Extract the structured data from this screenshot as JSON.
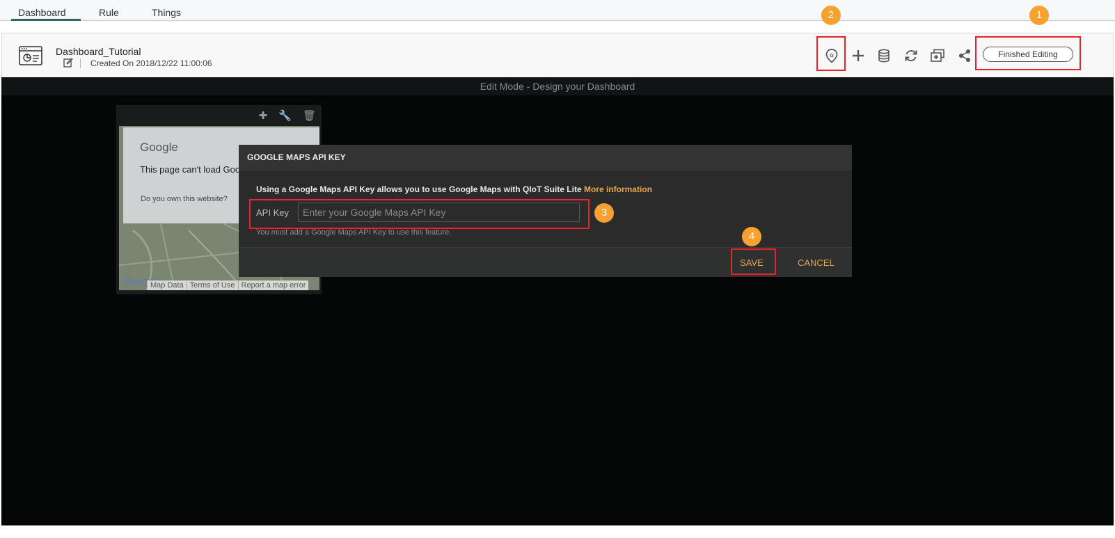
{
  "tabs": [
    {
      "label": "Dashboard"
    },
    {
      "label": "Rule"
    },
    {
      "label": "Things"
    }
  ],
  "header": {
    "title": "Dashboard_Tutorial",
    "created": "Created On 2018/12/22 11:00:06",
    "finish_label": "Finished Editing",
    "toolbar_icons": [
      "map-pin-icon",
      "plus-icon",
      "database-icon",
      "refresh-icon",
      "add-widget-icon",
      "share-icon"
    ]
  },
  "stage": {
    "edit_mode_label": "Edit Mode - Design your Dashboard"
  },
  "widget": {
    "map_error_brand": "Google",
    "map_error_message": "This page can't load Goo",
    "map_error_question": "Do you own this website?",
    "map_footer": [
      "Map Data",
      "Terms of Use",
      "Report a map error"
    ],
    "map_logo": "Google"
  },
  "dialog": {
    "title": "GOOGLE MAPS API KEY",
    "description": "Using a Google Maps API Key allows you to use Google Maps with QIoT Suite Lite",
    "more_info": "More information",
    "api_label": "API Key",
    "api_placeholder": "Enter your Google Maps API Key",
    "hint": "You must add a Google Maps API Key to use this feature.",
    "save_label": "SAVE",
    "cancel_label": "CANCEL"
  },
  "badges": [
    "1",
    "2",
    "3",
    "4"
  ],
  "colors": {
    "accent": "#e8a44c",
    "highlight": "#e8232b",
    "badge": "#f7a230"
  }
}
